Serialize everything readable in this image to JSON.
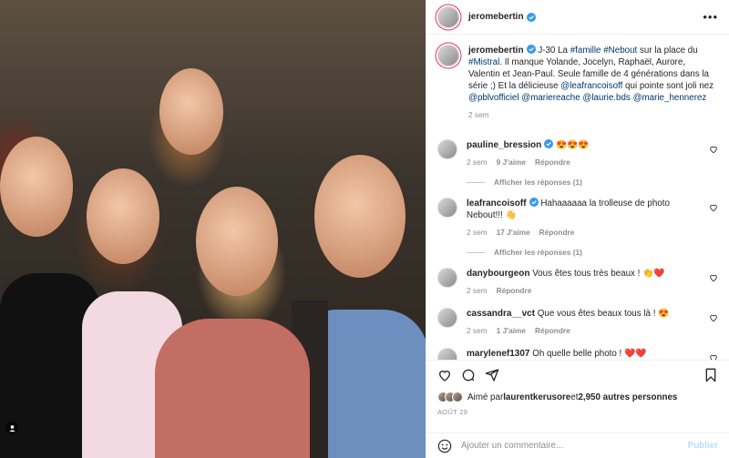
{
  "post": {
    "author": "jeromebertin",
    "caption": {
      "parts": [
        {
          "t": "J-30 La ",
          "tag": false
        },
        {
          "t": "#famille",
          "tag": true
        },
        {
          "t": " ",
          "tag": false
        },
        {
          "t": "#Nebout",
          "tag": true
        },
        {
          "t": " sur la place du ",
          "tag": false
        },
        {
          "t": "#Mistral",
          "tag": true
        },
        {
          "t": ". Il manque Yolande, Jocelyn, Raphaël, Aurore, Valentin et Jean-Paul. Seule famille de 4 générations dans la série ;) Et la délicieuse ",
          "tag": false
        },
        {
          "t": "@leafrancoisoff",
          "tag": true
        },
        {
          "t": " qui pointe sont joli nez ",
          "tag": false
        },
        {
          "t": "@pblvofficiel",
          "tag": true
        },
        {
          "t": " ",
          "tag": false
        },
        {
          "t": "@mariereache",
          "tag": true
        },
        {
          "t": " ",
          "tag": false
        },
        {
          "t": "@laurie.bds",
          "tag": true
        },
        {
          "t": " ",
          "tag": false
        },
        {
          "t": "@marie_hennerez",
          "tag": true
        }
      ],
      "age": "2 sem"
    },
    "comments": [
      {
        "user": "pauline_bression",
        "verified": true,
        "text": "😍😍😍",
        "age": "2 sem",
        "likes": "9 J'aime",
        "reply": "Répondre",
        "replies": "Afficher les réponses (1)"
      },
      {
        "user": "leafrancoisoff",
        "verified": true,
        "text": "Hahaaaaaa la trolleuse de photo Nebout!!! 👋",
        "age": "2 sem",
        "likes": "17 J'aime",
        "reply": "Répondre",
        "replies": "Afficher les réponses (1)"
      },
      {
        "user": "danybourgeon",
        "verified": false,
        "text": "Vous êtes tous très beaux ! 👏❤️",
        "age": "2 sem",
        "likes": "",
        "reply": "Répondre",
        "replies": ""
      },
      {
        "user": "cassandra__vct",
        "verified": false,
        "text": "Que vous êtes beaux tous là ! 😍",
        "age": "2 sem",
        "likes": "1 J'aime",
        "reply": "Répondre",
        "replies": ""
      },
      {
        "user": "marylenef1307",
        "verified": false,
        "text": "Oh quelle belle photo ! ❤️❤️",
        "age": "",
        "likes": "",
        "reply": "",
        "replies": ""
      }
    ],
    "liked_by": {
      "prefix": "Aimé par ",
      "user": "laurentkerusore",
      "middle": " et ",
      "count": "2,950 autres personnes"
    },
    "date": "AOÛT 29",
    "add_comment": {
      "placeholder": "Ajouter un commentaire...",
      "publish": "Publier"
    }
  },
  "colors": {
    "link": "#00376b",
    "verified": "#3897f0",
    "publish_disabled": "#b2dffc",
    "heart_red": "#ed4956"
  }
}
